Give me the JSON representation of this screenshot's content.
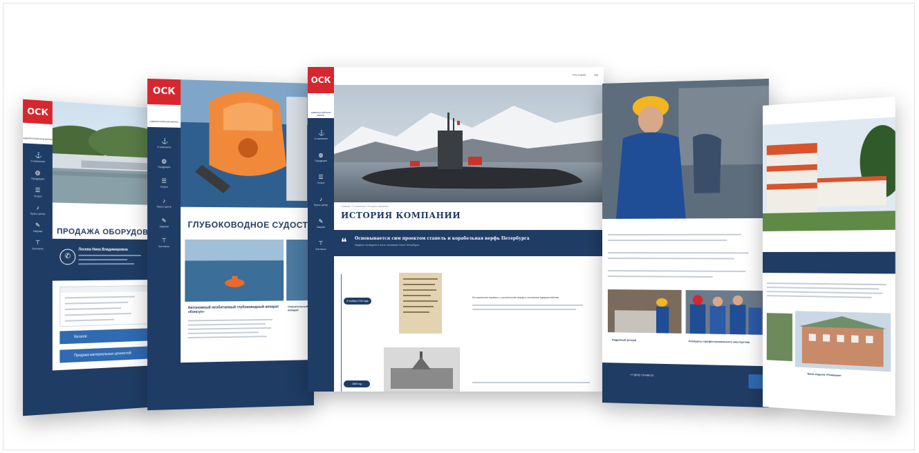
{
  "brand": {
    "logo_text": "ОСК",
    "sublogo": "АДМИРАЛТЕЙСКИЕ ВЕРФИ"
  },
  "nav_items": [
    "О компании",
    "Продукция",
    "Услуги",
    "Пресс-центр",
    "Закупки",
    "Контакты"
  ],
  "pages": {
    "p1": {
      "title": "ПРОДАЖА ОБОРУДОВАНИЯ",
      "contact_name": "Лосева Нина Владимировна",
      "btn1": "Каталог",
      "btn2": "Продажа материальных ценностей"
    },
    "p2": {
      "title": "ГЛУБОКОВОДНОЕ СУДОСТРОЕНИЕ",
      "caption1": "Автономный необитаемый глубоководный аппарат «Консул»",
      "caption2": "Спасательный аппарат"
    },
    "p3": {
      "lang_ru": "РУССКИЙ",
      "lang_en": "EN",
      "breadcrumb": "Главная / О компании / История компании",
      "title": "ИСТОРИЯ КОМПАНИИ",
      "quote_title": "Основывается сим проектом стапель и корабельная верфь Петербурга",
      "quote_sub": "Надпись на медали в честь основания Санкт-Петербурга",
      "year1": "5 ноября 1704 года",
      "year2": "1800 год",
      "history_text": "Историческая справка о строительстве верфи и основании Адмиралтейства"
    },
    "p4": {
      "caption1": "Кадровый резерв",
      "caption2": "Конкурсы профессионального мастерства",
      "phone": "+7 (812) 714-88-12"
    },
    "p5": {
      "caption": "База отдыха «Ромашка»"
    }
  },
  "colors": {
    "navy": "#1f3c64",
    "red": "#d7262e",
    "accent_blue": "#2f6ab3"
  }
}
